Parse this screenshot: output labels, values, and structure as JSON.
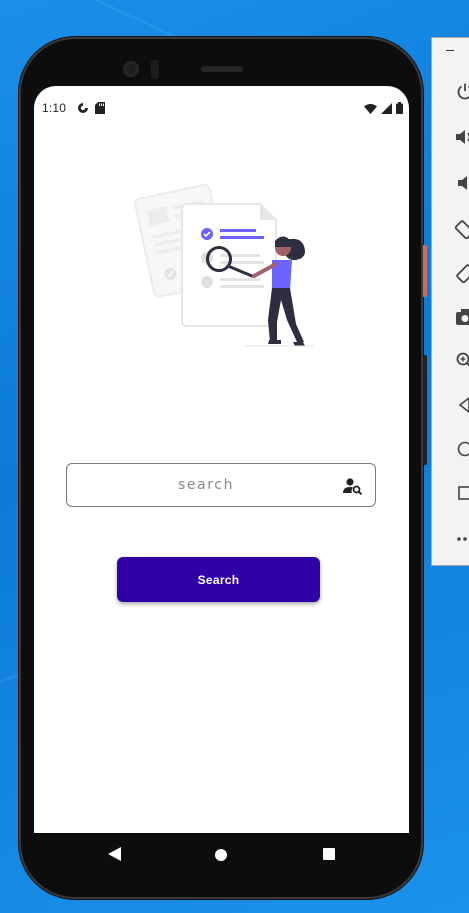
{
  "status_bar": {
    "time": "1:10"
  },
  "search": {
    "placeholder": "search",
    "value": ""
  },
  "primary_button": {
    "label": "Search"
  },
  "colors": {
    "accent": "#3000a8",
    "illustration_purple": "#6c63ff",
    "desktop_background": "#1486e6"
  },
  "icons": {
    "status_left": [
      "data-saver-icon",
      "sd-card-icon"
    ],
    "status_right": [
      "wifi-icon",
      "signal-icon",
      "battery-icon"
    ],
    "search_field": "person-search-icon",
    "navigation": [
      "back-icon",
      "home-icon",
      "recents-icon"
    ],
    "emulator_toolbar": [
      "power-icon",
      "volume-up-icon",
      "volume-down-icon",
      "rotate-left-icon",
      "rotate-right-icon",
      "camera-icon",
      "zoom-icon",
      "back-icon",
      "home-icon",
      "overview-icon",
      "more-icon"
    ]
  }
}
